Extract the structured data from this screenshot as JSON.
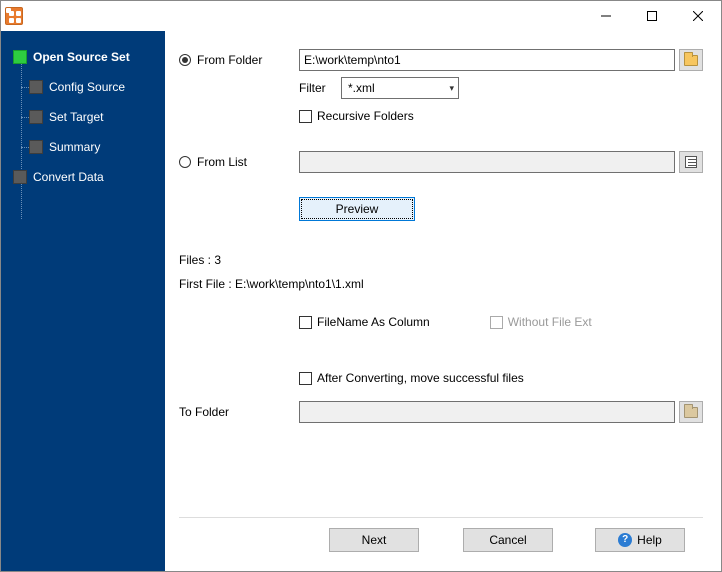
{
  "sidebar": {
    "items": [
      {
        "label": "Open Source Set",
        "active": true
      },
      {
        "label": "Config Source"
      },
      {
        "label": "Set Target"
      },
      {
        "label": "Summary"
      },
      {
        "label": "Convert Data"
      }
    ]
  },
  "form": {
    "from_folder_label": "From Folder",
    "from_folder_value": "E:\\work\\temp\\nto1",
    "filter_label": "Filter",
    "filter_value": "*.xml",
    "recursive_label": "Recursive Folders",
    "from_list_label": "From List",
    "from_list_value": "",
    "preview_label": "Preview",
    "files_label": "Files : 3",
    "first_file_label": "First File : E:\\work\\temp\\nto1\\1.xml",
    "filename_col_label": "FileName As Column",
    "without_ext_label": "Without File Ext",
    "after_convert_label": "After Converting, move successful files",
    "to_folder_label": "To Folder",
    "to_folder_value": ""
  },
  "footer": {
    "next": "Next",
    "cancel": "Cancel",
    "help": "Help"
  }
}
